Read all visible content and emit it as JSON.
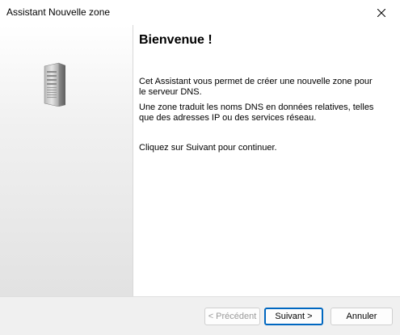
{
  "window": {
    "title": "Assistant Nouvelle zone"
  },
  "icons": {
    "close": "close-icon",
    "server": "server-tower-icon"
  },
  "content": {
    "heading": "Bienvenue !",
    "paragraph1": "Cet Assistant vous permet de créer une nouvelle zone pour le serveur DNS.",
    "paragraph2": "Une zone traduit les noms DNS en données relatives, telles que des adresses IP ou des services réseau.",
    "paragraph3": "Cliquez sur Suivant pour continuer."
  },
  "buttons": {
    "back_label": "< Précédent",
    "back_enabled": false,
    "next_label": "Suivant >",
    "cancel_label": "Annuler"
  },
  "colors": {
    "accent": "#0067c0",
    "footer": "#f0f0f0",
    "disabled_text": "#9a9a9a"
  }
}
